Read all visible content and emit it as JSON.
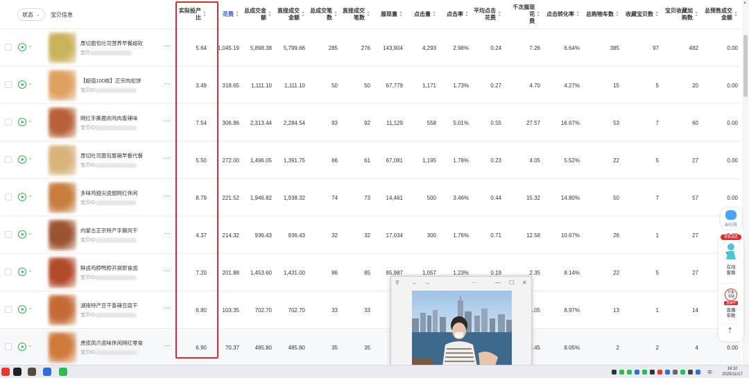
{
  "header": {
    "status_label": "状态",
    "product_info_label": "宝贝信息",
    "columns": [
      {
        "key": "roi",
        "label_line1": "实际投产",
        "label_line2": "比",
        "color": "#333333"
      },
      {
        "key": "spend",
        "label_line1": "花费",
        "label_line2": "",
        "color": "#2f54eb"
      },
      {
        "key": "gmv",
        "label_line1": "总成交金",
        "label_line2": "额",
        "color": "#333333"
      },
      {
        "key": "direct_gmv",
        "label_line1": "直接成交",
        "label_line2": "金额",
        "color": "#333333"
      },
      {
        "key": "orders",
        "label_line1": "总成交笔",
        "label_line2": "数",
        "color": "#333333"
      },
      {
        "key": "direct_orders",
        "label_line1": "直接成交",
        "label_line2": "笔数",
        "color": "#333333"
      },
      {
        "key": "impressions",
        "label_line1": "展现量",
        "label_line2": "",
        "color": "#333333"
      },
      {
        "key": "clicks",
        "label_line1": "点击量",
        "label_line2": "",
        "color": "#333333"
      },
      {
        "key": "ctr",
        "label_line1": "点击率",
        "label_line2": "",
        "color": "#333333"
      },
      {
        "key": "cpc",
        "label_line1": "平均点击",
        "label_line2": "花费",
        "color": "#333333"
      },
      {
        "key": "cpm",
        "label_line1": "千次展现花",
        "label_line2": "费",
        "color": "#333333"
      },
      {
        "key": "cvr",
        "label_line1": "点击转化率",
        "label_line2": "",
        "color": "#333333"
      },
      {
        "key": "cart",
        "label_line1": "总购物车数",
        "label_line2": "",
        "color": "#333333"
      },
      {
        "key": "fav",
        "label_line1": "收藏宝贝数",
        "label_line2": "",
        "color": "#333333"
      },
      {
        "key": "fav_cart",
        "label_line1": "宝贝收藏加",
        "label_line2": "购数",
        "color": "#333333"
      },
      {
        "key": "presale",
        "label_line1": "总预售成交",
        "label_line2": "金额",
        "color": "#333333"
      }
    ]
  },
  "rows": [
    {
      "name": "厚切面包吐司营养早餐超软",
      "id_prefix": "宝贝",
      "values": [
        "5.64",
        "1,045.19",
        "5,898.38",
        "5,799.66",
        "285",
        "276",
        "143,904",
        "4,293",
        "2.98%",
        "0.24",
        "7.26",
        "6.64%",
        "385",
        "97",
        "482",
        "0.00"
      ],
      "thumb_color": "#c9b25a",
      "highlight": false
    },
    {
      "name": "【超值100枚】正宗肉松饼",
      "id_prefix": "宝贝ID",
      "values": [
        "3.49",
        "318.65",
        "1,111.10",
        "1,111.10",
        "50",
        "50",
        "67,779",
        "1,171",
        "1.73%",
        "0.27",
        "4.70",
        "4.27%",
        "15",
        "5",
        "20",
        "0.00"
      ],
      "thumb_color": "#e0a060",
      "highlight": false
    },
    {
      "name": "网红手撕鹿肉鸡肉香辣味",
      "id_prefix": "宝贝ID",
      "values": [
        "7.54",
        "306.86",
        "2,313.44",
        "2,284.54",
        "93",
        "92",
        "11,129",
        "558",
        "5.01%",
        "0.55",
        "27.57",
        "16.67%",
        "53",
        "7",
        "60",
        "0.00"
      ],
      "thumb_color": "#b8603a",
      "highlight": false
    },
    {
      "name": "厚切吐司面包整箱早餐代餐",
      "id_prefix": "宝贝ID",
      "values": [
        "5.50",
        "272.00",
        "1,496.05",
        "1,391.75",
        "66",
        "61",
        "67,081",
        "1,195",
        "1.78%",
        "0.23",
        "4.05",
        "5.52%",
        "22",
        "5",
        "27",
        "0.00"
      ],
      "thumb_color": "#d8b47a",
      "highlight": false
    },
    {
      "name": "多味鸡翅尖卤翅网红休闲",
      "id_prefix": "宝贝ID",
      "values": [
        "8.79",
        "221.52",
        "1,946.82",
        "1,938.32",
        "74",
        "73",
        "14,461",
        "500",
        "3.46%",
        "0.44",
        "15.32",
        "14.80%",
        "50",
        "7",
        "57",
        "0.00"
      ],
      "thumb_color": "#c77d3e",
      "highlight": false
    },
    {
      "name": "内蒙古正宗特产手撕风干",
      "id_prefix": "宝贝ID",
      "values": [
        "4.37",
        "214.32",
        "936.43",
        "936.43",
        "32",
        "32",
        "17,034",
        "300",
        "1.76%",
        "0.71",
        "12.58",
        "10.67%",
        "26",
        "1",
        "27",
        "0.00"
      ],
      "thumb_color": "#9a5432",
      "highlight": false
    },
    {
      "name": "鲜卤鸡脖鸭脖开袋即食卤",
      "id_prefix": "宝贝ID",
      "values": [
        "7.20",
        "201.88",
        "1,453.60",
        "1,431.00",
        "86",
        "85",
        "85,987",
        "1,057",
        "1.23%",
        "0.19",
        "2.35",
        "8.14%",
        "22",
        "5",
        "27",
        "0.00"
      ],
      "thumb_color": "#b24a2c",
      "highlight": false
    },
    {
      "name": "湖南特产豆干香辣豆腐干",
      "id_prefix": "宝贝ID",
      "values": [
        "6.80",
        "103.35",
        "702.70",
        "702.70",
        "33",
        "33",
        "1",
        "",
        "",
        "",
        "5.05",
        "8.97%",
        "13",
        "1",
        "14",
        "0.00"
      ],
      "thumb_color": "#c46a36",
      "highlight": false
    },
    {
      "name": "虎皮凤爪卤味休闲网红零食",
      "id_prefix": "宝贝ID",
      "values": [
        "6.90",
        "70.37",
        "485.80",
        "485.80",
        "35",
        "35",
        "2",
        "",
        "",
        "",
        "2.45",
        "8.05%",
        "2",
        "2",
        "4",
        "0.00"
      ],
      "thumb_color": "#d07a3c",
      "highlight": true
    }
  ],
  "float_panel": {
    "ai_label": "AI小万",
    "badge": "有新消息",
    "service_label_1": "在线",
    "service_label_2": "客服",
    "circle_label_1": "万象",
    "circle_label_2": "书院",
    "red_tag": "直播中",
    "live_label_1": "直播",
    "live_label_2": "带教",
    "top_icon": "arrow-up-icon"
  },
  "video_window": {
    "pin_icon": "pin-icon",
    "back_icon": "arrow-left-icon",
    "forward_icon": "arrow-right-icon",
    "more_label": "···",
    "min_label": "—",
    "max_label": "☐",
    "close_label": "✕"
  },
  "taskbar": {
    "time": "16:10",
    "date": "2025/11/17",
    "lang": "中"
  },
  "colors": {
    "highlight_box": "#e0292b",
    "accent_blue": "#2f54eb",
    "play_green": "#2fb344"
  }
}
